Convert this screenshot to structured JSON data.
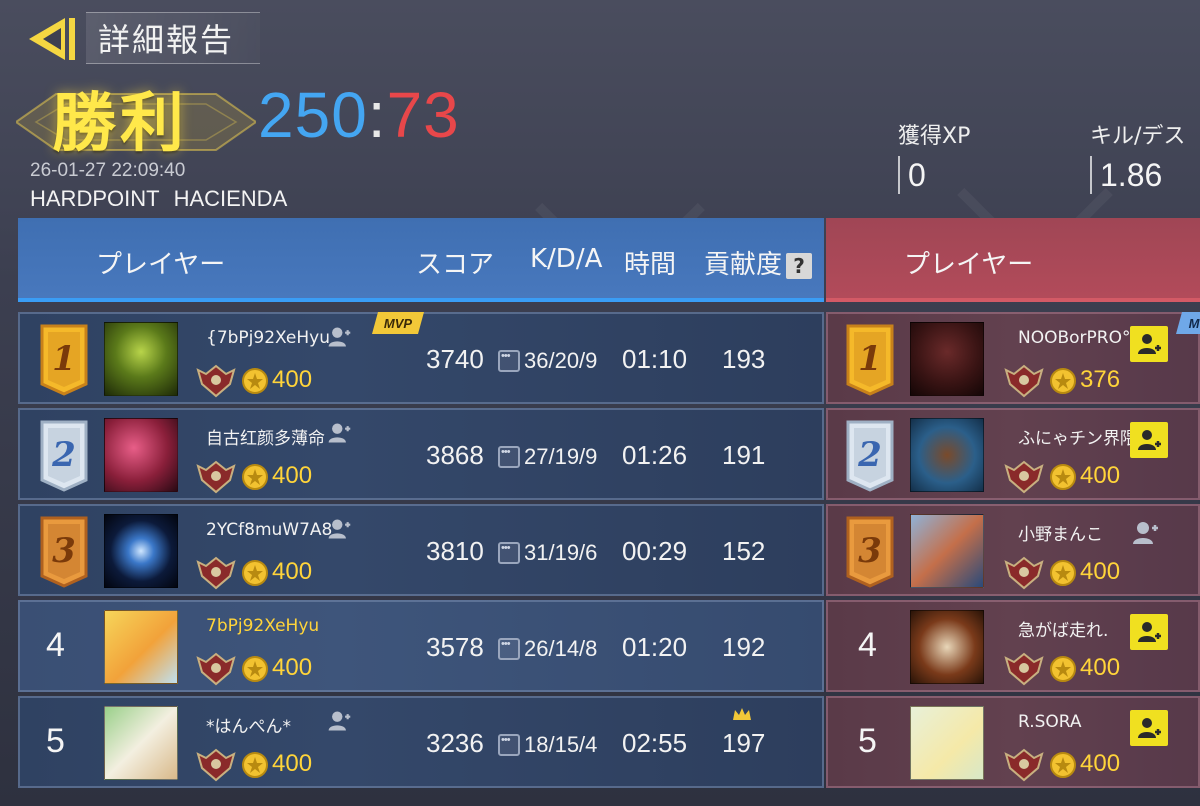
{
  "header": {
    "title": "詳細報告",
    "result": "勝利",
    "score_blue": "250",
    "score_separator": ":",
    "score_red": "73",
    "datetime": "26-01-27 22:09:40",
    "mode": "HARDPOINT",
    "map": "HACIENDA"
  },
  "stats": {
    "xp_label": "獲得XP",
    "xp_value": "0",
    "kd_label": "キル/デス",
    "kd_value": "1.86"
  },
  "blue_header": {
    "player": "プレイヤー",
    "score": "スコア",
    "kda": "K/D/A",
    "time": "時間",
    "contribution": "貢献度",
    "help": "?"
  },
  "red_header": {
    "player": "プレイヤー"
  },
  "blue_players": [
    {
      "rank": "1",
      "name": "{7bPj92XeHyu",
      "level": "400",
      "mvp": "MVP",
      "score": "3740",
      "kda": "36/20/9",
      "time": "01:10",
      "contribution": "193"
    },
    {
      "rank": "2",
      "name": "自古红颜多薄命",
      "level": "400",
      "score": "3868",
      "kda": "27/19/9",
      "time": "01:26",
      "contribution": "191"
    },
    {
      "rank": "3",
      "name": "2YCf8muW7A8",
      "level": "400",
      "score": "3810",
      "kda": "31/19/6",
      "time": "00:29",
      "contribution": "152"
    },
    {
      "rank": "4",
      "name": "7bPj92XeHyu",
      "level": "400",
      "score": "3578",
      "kda": "26/14/8",
      "time": "01:20",
      "contribution": "192"
    },
    {
      "rank": "5",
      "name": "*はんぺん*",
      "level": "400",
      "score": "3236",
      "kda": "18/15/4",
      "time": "02:55",
      "contribution": "197"
    }
  ],
  "red_players": [
    {
      "rank": "1",
      "name": "NOOBorPRO°",
      "level": "376",
      "mvp": "M"
    },
    {
      "rank": "2",
      "name": "ふにゃチン界隈",
      "level": "400"
    },
    {
      "rank": "3",
      "name": "小野まんこ",
      "level": "400"
    },
    {
      "rank": "4",
      "name": "急がば走れ.",
      "level": "400"
    },
    {
      "rank": "5",
      "name": "R.SORA",
      "level": "400"
    }
  ],
  "colors": {
    "blue_team": "#44a6f2",
    "red_team": "#e8474a",
    "gold": "#ffd43a",
    "victory": "#ffe84a"
  }
}
